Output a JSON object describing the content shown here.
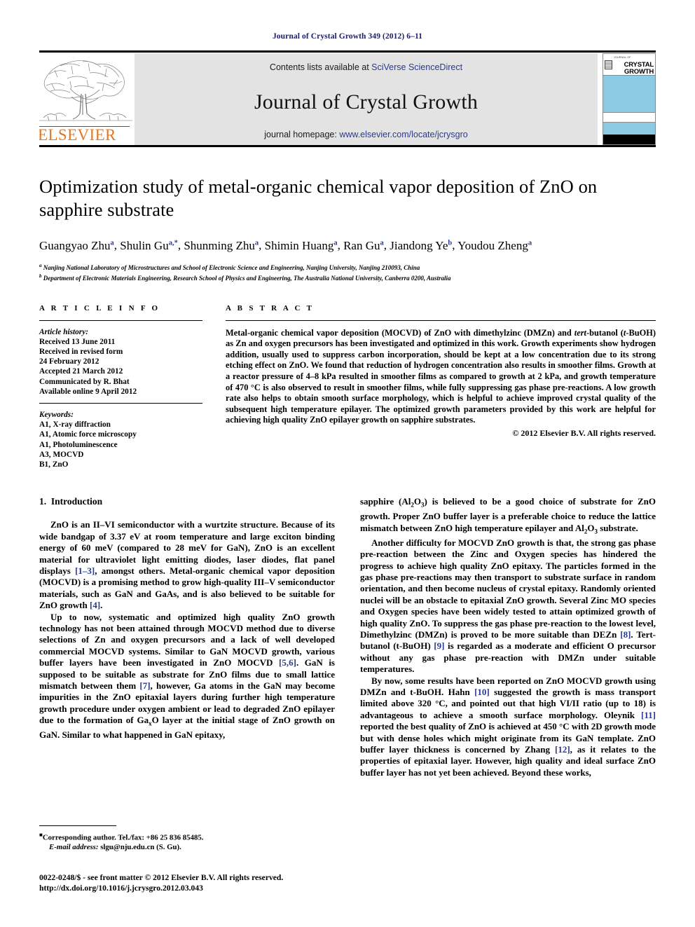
{
  "running_head": "Journal of Crystal Growth 349 (2012) 6–11",
  "masthead": {
    "elsevier_label": "ELSEVIER",
    "contents_prefix": "Contents lists available at ",
    "contents_link": "SciVerse ScienceDirect",
    "journal_title": "Journal of Crystal Growth",
    "homepage_prefix": "journal homepage: ",
    "homepage_link": "www.elsevier.com/locate/jcrysgro",
    "cover_tiny": "JOURNAL OF",
    "cover_line1": "CRYSTAL",
    "cover_line2": "GROWTH",
    "cover_blue": "#8dcbe4",
    "accent_orange": "#E87722",
    "link_blue": "#2b3a8f"
  },
  "article": {
    "title": "Optimization study of metal-organic chemical vapor deposition of ZnO on sapphire substrate",
    "affiliation_a": "Nanjing National Laboratory of Microstructures and School of Electronic Science and Engineering, Nanjing University, Nanjing 210093, China",
    "affiliation_b": "Department of Electronic Materials Engineering, Research School of Physics and Engineering, The Australia National University, Canberra 0200, Australia",
    "authors": [
      {
        "name": "Guangyao Zhu",
        "marks": "a"
      },
      {
        "name": "Shulin Gu",
        "marks": "a,*"
      },
      {
        "name": "Shunming Zhu",
        "marks": "a"
      },
      {
        "name": "Shimin Huang",
        "marks": "a"
      },
      {
        "name": "Ran Gu",
        "marks": "a"
      },
      {
        "name": "Jiandong Ye",
        "marks": "b"
      },
      {
        "name": "Youdou Zheng",
        "marks": "a"
      }
    ]
  },
  "article_info": {
    "heading": "A R T I C L E  I N F O",
    "history_label": "Article history:",
    "history_lines": [
      "Received 13 June 2011",
      "Received in revised form",
      "24 February 2012",
      "Accepted 21 March 2012",
      "Communicated by R. Bhat",
      "Available online 9 April 2012"
    ],
    "keywords_label": "Keywords:",
    "keywords": [
      "A1, X-ray diffraction",
      "A1, Atomic force microscopy",
      "A1, Photoluminescence",
      "A3, MOCVD",
      "B1, ZnO"
    ]
  },
  "abstract": {
    "heading": "A B S T R A C T",
    "text_part1": "Metal-organic chemical vapor deposition (MOCVD) of ZnO with dimethylzinc (DMZn) and ",
    "italic1": "tert",
    "text_part2": "-butanol (",
    "italic2": "t",
    "text_part3": "-BuOH) as Zn and oxygen precursors has been investigated and optimized in this work. Growth experiments show hydrogen addition, usually used to suppress carbon incorporation, should be kept at a low concentration due to its strong etching effect on ZnO. We found that reduction of hydrogen concentration also results in smoother films. Growth at a reactor pressure of 4–8 kPa resulted in smoother films as compared to growth at 2 kPa, and growth temperature of 470 °C is also observed to result in smoother films, while fully suppressing gas phase pre-reactions. A low growth rate also helps to obtain smooth surface morphology, which is helpful to achieve improved crystal quality of the subsequent high temperature epilayer. The optimized growth parameters provided by this work are helpful for achieving high quality ZnO epilayer growth on sapphire substrates.",
    "copyright": "© 2012 Elsevier B.V. All rights reserved."
  },
  "body": {
    "section_number": "1.",
    "section_title": "Introduction",
    "left_p1_a": "ZnO is an II–VI semiconductor with a wurtzite structure. Because of its wide bandgap of 3.37 eV at room temperature and large exciton binding energy of 60 meV (compared to 28 meV for GaN), ZnO is an excellent material for ultraviolet light emitting diodes, laser diodes, flat panel displays ",
    "left_p1_ref1": "[1–3]",
    "left_p1_b": ", amongst others. Metal-organic chemical vapor deposition (MOCVD) is a promising method to grow high-quality III–V semiconductor materials, such as GaN and GaAs, and is also believed to be suitable for ZnO growth ",
    "left_p1_ref2": "[4]",
    "left_p1_c": ".",
    "left_p2_a": "Up to now, systematic and optimized high quality ZnO growth technology has not been attained through MOCVD method due to diverse selections of Zn and oxygen precursors and a lack of well developed commercial MOCVD systems. Similar to GaN MOCVD growth, various buffer layers have been investigated in ZnO MOCVD ",
    "left_p2_ref1": "[5,6]",
    "left_p2_b": ". GaN is supposed to be suitable as substrate for ZnO films due to small lattice mismatch between them ",
    "left_p2_ref2": "[7]",
    "left_p2_c": ", however, Ga atoms in the GaN may become impurities in the ZnO epitaxial layers during further high temperature growth procedure under oxygen ambient or lead to degraded ZnO epilayer due to the formation of Ga",
    "left_p2_sub": "x",
    "left_p2_d": "O layer at the initial stage of ZnO growth on GaN. Similar to what happened in GaN epitaxy,",
    "right_p1": "sapphire (Al2O3) is believed to be a good choice of substrate for ZnO growth. Proper ZnO buffer layer is a preferable choice to reduce the lattice mismatch between ZnO high temperature epilayer and Al2O3 substrate.",
    "right_p2_a": "Another difficulty for MOCVD ZnO growth is that, the strong gas phase pre-reaction between the Zinc and Oxygen species has hindered the progress to achieve high quality ZnO epitaxy. The particles formed in the gas phase pre-reactions may then transport to substrate surface in random orientation, and then become nucleus of crystal epitaxy. Randomly oriented nuclei will be an obstacle to epitaxial ZnO growth. Several Zinc MO species and Oxygen species have been widely tested to attain optimized growth of high quality ZnO. To suppress the gas phase pre-reaction to the lowest level, Dimethylzinc (DMZn) is proved to be more suitable than DEZn ",
    "right_p2_ref1": "[8]",
    "right_p2_b": ". Tert-butanol (t-BuOH) ",
    "right_p2_ref2": "[9]",
    "right_p2_c": " is regarded as a moderate and efficient O precursor without any gas phase pre-reaction with DMZn under suitable temperatures.",
    "right_p3_a": "By now, some results have been reported on ZnO MOCVD growth using DMZn and t-BuOH. Hahn ",
    "right_p3_ref1": "[10]",
    "right_p3_b": " suggested the growth is mass transport limited above 320 °C, and pointed out that high VI/II ratio (up to 18) is advantageous to achieve a smooth surface morphology. Oleynik ",
    "right_p3_ref2": "[11]",
    "right_p3_c": " reported the best quality of ZnO is achieved at 450 °C with 2D growth mode but with dense holes which might originate from its GaN template. ZnO buffer layer thickness is concerned by Zhang ",
    "right_p3_ref3": "[12]",
    "right_p3_d": ", as it relates to the properties of epitaxial layer. However, high quality and ideal surface ZnO buffer layer has not yet been achieved. Beyond these works,"
  },
  "footnotes": {
    "corresponding": "Corresponding author. Tel./fax: +86 25 836 85485.",
    "email_label": "E-mail address:",
    "email_value": "slgu@nju.edu.cn (S. Gu)."
  },
  "footer": {
    "issn_line": "0022-0248/$ - see front matter © 2012 Elsevier B.V. All rights reserved.",
    "doi_line": "http://dx.doi.org/10.1016/j.jcrysgro.2012.03.043"
  }
}
